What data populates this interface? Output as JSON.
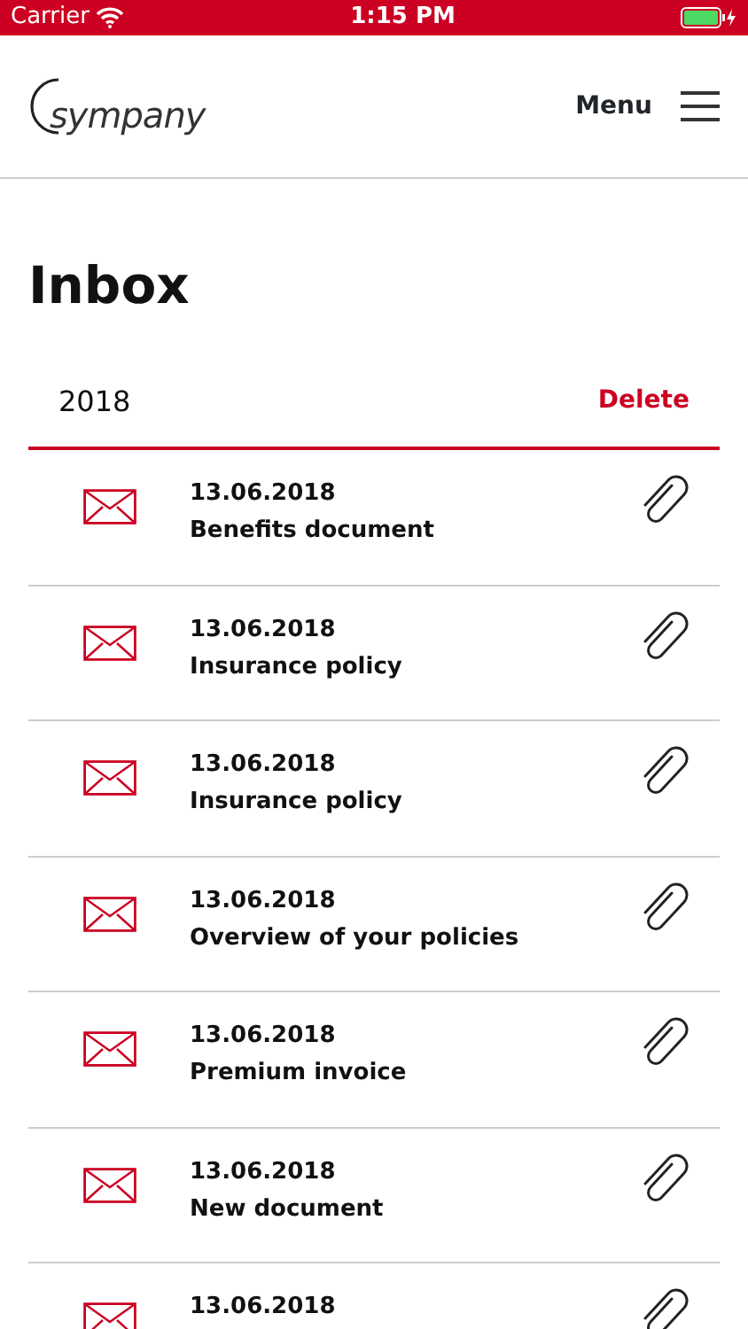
{
  "status_bar": {
    "carrier": "Carrier",
    "time": "1:15 PM"
  },
  "header": {
    "logo": "sympany",
    "menu_label": "Menu"
  },
  "title": "Inbox",
  "filter": {
    "year": "2018",
    "delete": "Delete"
  },
  "messages": [
    {
      "date": "13.06.2018",
      "subject": "Benefits document",
      "attachment": true
    },
    {
      "date": "13.06.2018",
      "subject": "Insurance policy",
      "attachment": true
    },
    {
      "date": "13.06.2018",
      "subject": "Insurance policy",
      "attachment": true
    },
    {
      "date": "13.06.2018",
      "subject": "Overview of your policies",
      "attachment": true
    },
    {
      "date": "13.06.2018",
      "subject": "Premium invoice",
      "attachment": true
    },
    {
      "date": "13.06.2018",
      "subject": "New document",
      "attachment": true
    },
    {
      "date": "13.06.2018",
      "attachment": true
    }
  ]
}
